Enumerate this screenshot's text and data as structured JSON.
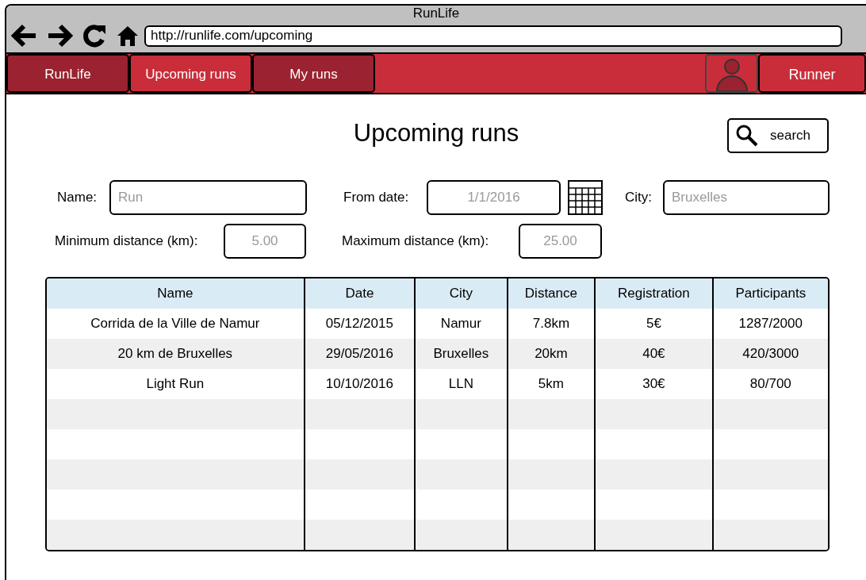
{
  "browser": {
    "title": "RunLife",
    "url": "http://runlife.com/upcoming"
  },
  "nav": {
    "tabs": [
      {
        "label": "RunLife",
        "selected": false
      },
      {
        "label": "Upcoming runs",
        "selected": true
      },
      {
        "label": "My runs",
        "selected": false
      }
    ],
    "user": {
      "label": "Runner"
    }
  },
  "page_title": "Upcoming runs",
  "search_button": "search",
  "filters": [
    [
      {
        "label": "Name:",
        "placeholder": "Run",
        "kind": "text"
      },
      {
        "label": "From date:",
        "placeholder": "1/1/2016",
        "kind": "date"
      },
      {
        "label": "City:",
        "placeholder": "Bruxelles",
        "kind": "text"
      }
    ],
    [
      {
        "label": "Minimum distance (km):",
        "placeholder": "5.00",
        "kind": "number"
      },
      {
        "label": "Maximum distance (km):",
        "placeholder": "25.00",
        "kind": "number"
      }
    ]
  ],
  "table": {
    "columns": [
      "Name",
      "Date",
      "City",
      "Distance",
      "Registration",
      "Participants"
    ],
    "rows": [
      [
        "Corrida de la Ville de Namur",
        "05/12/2015",
        "Namur",
        "7.8km",
        "5€",
        "1287/2000"
      ],
      [
        "20 km de Bruxelles",
        "29/05/2016",
        "Bruxelles",
        "20km",
        "40€",
        "420/3000"
      ],
      [
        "Light Run",
        "10/10/2016",
        "LLN",
        "5km",
        "30€",
        "80/700"
      ]
    ]
  }
}
